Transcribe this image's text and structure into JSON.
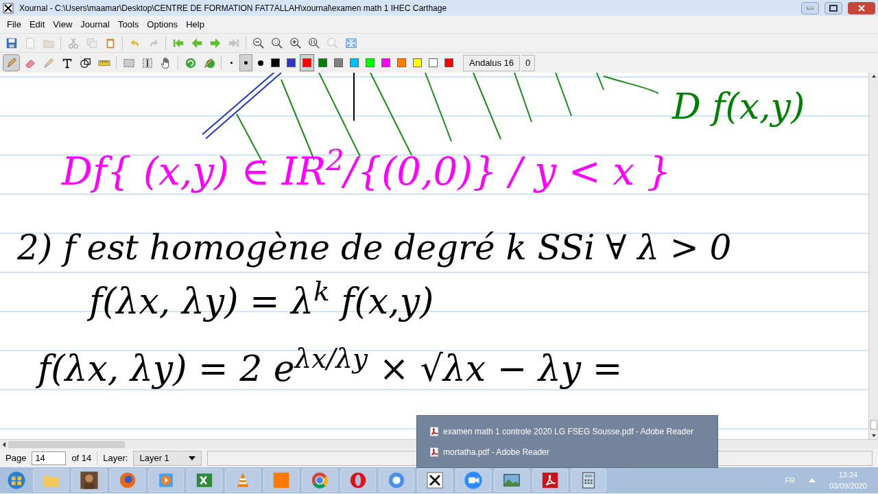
{
  "window": {
    "title": "Xournal - C:\\Users\\maamar\\Desktop\\CENTRE DE FORMATION FAT7ALLAH\\xournal\\examen math 1 IHEC Carthage"
  },
  "menu": [
    "File",
    "Edit",
    "View",
    "Journal",
    "Tools",
    "Options",
    "Help"
  ],
  "toolbar": [
    {
      "kind": "save",
      "disabled": false
    },
    {
      "kind": "new",
      "disabled": true
    },
    {
      "kind": "open",
      "disabled": true
    },
    {
      "kind": "sep"
    },
    {
      "kind": "cut",
      "disabled": true
    },
    {
      "kind": "copy",
      "disabled": true
    },
    {
      "kind": "paste",
      "disabled": false
    },
    {
      "kind": "sep"
    },
    {
      "kind": "undo",
      "disabled": false
    },
    {
      "kind": "redo",
      "disabled": true
    },
    {
      "kind": "sep"
    },
    {
      "kind": "first",
      "disabled": false
    },
    {
      "kind": "prev",
      "disabled": false
    },
    {
      "kind": "next",
      "disabled": false
    },
    {
      "kind": "last",
      "disabled": true
    },
    {
      "kind": "sep"
    },
    {
      "kind": "zoomout",
      "disabled": false
    },
    {
      "kind": "zoomfit",
      "disabled": false
    },
    {
      "kind": "zoomin",
      "disabled": false
    },
    {
      "kind": "zoom100",
      "disabled": false
    },
    {
      "kind": "zoomset",
      "disabled": true
    },
    {
      "kind": "fullscreen",
      "disabled": false
    }
  ],
  "tools": [
    {
      "kind": "pen",
      "selected": true
    },
    {
      "kind": "eraser",
      "selected": false
    },
    {
      "kind": "highlighter",
      "selected": false
    },
    {
      "kind": "text",
      "selected": false
    },
    {
      "kind": "shape",
      "selected": false
    },
    {
      "kind": "ruler",
      "selected": false
    },
    {
      "kind": "sep"
    },
    {
      "kind": "selectrect",
      "selected": false
    },
    {
      "kind": "vspace",
      "selected": false
    },
    {
      "kind": "hand",
      "selected": false
    },
    {
      "kind": "sep"
    },
    {
      "kind": "default",
      "selected": false
    },
    {
      "kind": "defaultpen",
      "selected": false
    }
  ],
  "sizes": [
    {
      "selected": false
    },
    {
      "selected": true
    },
    {
      "selected": false
    }
  ],
  "colors": [
    {
      "color": "#000000",
      "selected": false
    },
    {
      "color": "#3333cc",
      "selected": false
    },
    {
      "color": "#ff0000",
      "selected": true
    },
    {
      "color": "#008000",
      "selected": false
    },
    {
      "color": "#808080",
      "selected": false
    },
    {
      "color": "#00c0ff",
      "selected": false
    },
    {
      "color": "#00ff00",
      "selected": false
    },
    {
      "color": "#ff00ff",
      "selected": false
    },
    {
      "color": "#ff8000",
      "selected": false
    },
    {
      "color": "#ffff00",
      "selected": false
    },
    {
      "color": "#ffffff",
      "selected": false
    },
    {
      "color": "#ff0000",
      "selected": false
    }
  ],
  "font_button": "Andalus 16",
  "width_field": "0",
  "ink": [
    {
      "text": "D f(x,y)",
      "color": "#008000"
    },
    {
      "text": "Df{ (x,y) ∈ IR$^{2}$/{(0,0)} / y < x }",
      "color": "#ff00ff"
    },
    {
      "text": "2) f est homogène de degré k SSi ∀ λ > 0",
      "color": "#000000"
    },
    {
      "text": "f(λx, λy) = λ$^{k}$ f(x,y)",
      "color": "#000000"
    },
    {
      "text": "f(λx, λy) = 2 e$^{λx/λy}$ × √λx − λy =",
      "color": "#000000"
    }
  ],
  "status": {
    "page_label": "Page",
    "page": "14",
    "of": "of 14",
    "layer_label": "Layer:",
    "layer": "Layer 1"
  },
  "popup": [
    "examen math 1 controle 2020 LG FSEG Sousse.pdf - Adobe Reader",
    "mortatha.pdf - Adobe Reader"
  ],
  "tray": {
    "lang": "FR",
    "time": "13:24",
    "date": "03/09/2020"
  }
}
